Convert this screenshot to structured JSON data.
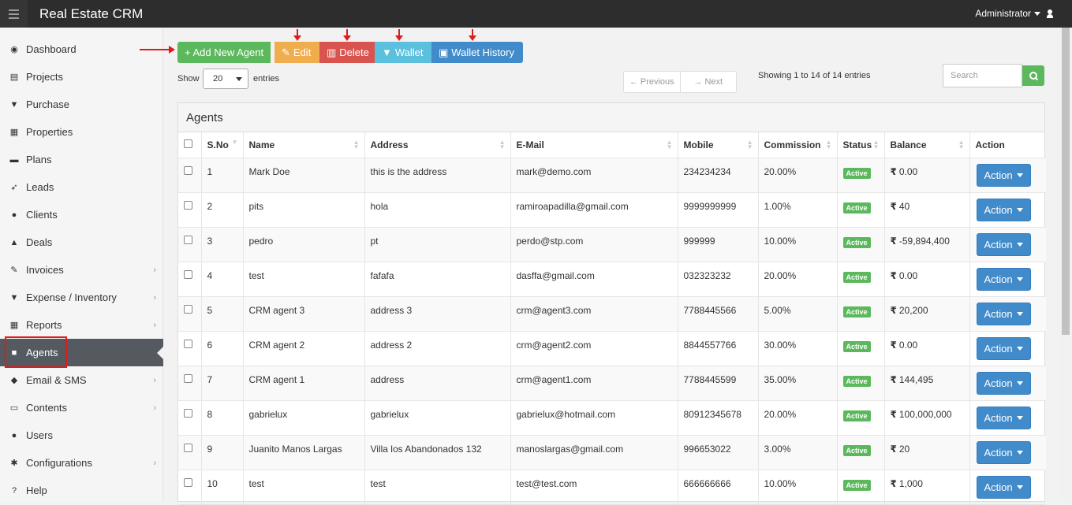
{
  "app": {
    "title": "Real Estate CRM",
    "user": "Administrator"
  },
  "colors": {
    "topbar": "#2d2d2d",
    "success": "#5cb85c",
    "warning": "#f0ad4e",
    "danger": "#d9534f",
    "info": "#5bc0de",
    "primary": "#428bca",
    "annotation": "#e01b1b"
  },
  "sidebar": {
    "items": [
      {
        "label": "Dashboard",
        "icon": "dashboard-icon",
        "glyph": "◉",
        "submenu": false
      },
      {
        "label": "Projects",
        "icon": "server-icon",
        "glyph": "▤",
        "submenu": false
      },
      {
        "label": "Purchase",
        "icon": "cart-icon",
        "glyph": "▼",
        "submenu": false
      },
      {
        "label": "Properties",
        "icon": "building-icon",
        "glyph": "▦",
        "submenu": false
      },
      {
        "label": "Plans",
        "icon": "briefcase-icon",
        "glyph": "▬",
        "submenu": false
      },
      {
        "label": "Leads",
        "icon": "rocket-icon",
        "glyph": "➶",
        "submenu": false
      },
      {
        "label": "Clients",
        "icon": "users-icon",
        "glyph": "●",
        "submenu": false
      },
      {
        "label": "Deals",
        "icon": "thumbs-up-icon",
        "glyph": "▲",
        "submenu": false
      },
      {
        "label": "Invoices",
        "icon": "pin-icon",
        "glyph": "✎",
        "submenu": true
      },
      {
        "label": "Expense / Inventory",
        "icon": "cart-icon",
        "glyph": "▼",
        "submenu": true
      },
      {
        "label": "Reports",
        "icon": "table-icon",
        "glyph": "▦",
        "submenu": true
      },
      {
        "label": "Agents",
        "icon": "agent-icon",
        "glyph": "■",
        "submenu": false,
        "active": true
      },
      {
        "label": "Email & SMS",
        "icon": "shield-icon",
        "glyph": "◆",
        "submenu": true
      },
      {
        "label": "Contents",
        "icon": "keyboard-icon",
        "glyph": "▭",
        "submenu": true
      },
      {
        "label": "Users",
        "icon": "user-icon",
        "glyph": "●",
        "submenu": false
      },
      {
        "label": "Configurations",
        "icon": "cogs-icon",
        "glyph": "✱",
        "submenu": true
      },
      {
        "label": "Help",
        "icon": "question-icon",
        "glyph": "?",
        "submenu": false
      }
    ]
  },
  "toolbar": {
    "add": "+ Add New Agent",
    "edit": "Edit",
    "delete": "Delete",
    "wallet": "Wallet",
    "wallet_history": "Wallet History"
  },
  "list": {
    "show_label": "Show",
    "entries_label": "entries",
    "page_size": "20",
    "previous": "← Previous",
    "next": "→ Next",
    "showing": "Showing 1 to 14 of 14 entries",
    "search_placeholder": "Search"
  },
  "panel": {
    "title": "Agents"
  },
  "table": {
    "headers": [
      "S.No",
      "Name",
      "Address",
      "E-Mail",
      "Mobile",
      "Commission",
      "Status",
      "Balance",
      "Action"
    ],
    "rows": [
      {
        "sno": "1",
        "name": "Mark Doe",
        "address": "this is the address",
        "email": "mark@demo.com",
        "mobile": "234234234",
        "commission": "20.00%",
        "status": "Active",
        "balance": "0.00",
        "action": "Action"
      },
      {
        "sno": "2",
        "name": "pits",
        "address": "hola",
        "email": "ramiroapadilla@gmail.com",
        "mobile": "9999999999",
        "commission": "1.00%",
        "status": "Active",
        "balance": "40",
        "action": "Action"
      },
      {
        "sno": "3",
        "name": "pedro",
        "address": "pt",
        "email": "perdo@stp.com",
        "mobile": "999999",
        "commission": "10.00%",
        "status": "Active",
        "balance": "-59,894,400",
        "action": "Action"
      },
      {
        "sno": "4",
        "name": "test",
        "address": "fafafa",
        "email": "dasffa@gmail.com",
        "mobile": "032323232",
        "commission": "20.00%",
        "status": "Active",
        "balance": "0.00",
        "action": "Action"
      },
      {
        "sno": "5",
        "name": "CRM agent 3",
        "address": "address 3",
        "email": "crm@agent3.com",
        "mobile": "7788445566",
        "commission": "5.00%",
        "status": "Active",
        "balance": "20,200",
        "action": "Action"
      },
      {
        "sno": "6",
        "name": "CRM agent 2",
        "address": "address 2",
        "email": "crm@agent2.com",
        "mobile": "8844557766",
        "commission": "30.00%",
        "status": "Active",
        "balance": "0.00",
        "action": "Action"
      },
      {
        "sno": "7",
        "name": "CRM agent 1",
        "address": "address",
        "email": "crm@agent1.com",
        "mobile": "7788445599",
        "commission": "35.00%",
        "status": "Active",
        "balance": "144,495",
        "action": "Action"
      },
      {
        "sno": "8",
        "name": "gabrielux",
        "address": "gabrielux",
        "email": "gabrielux@hotmail.com",
        "mobile": "80912345678",
        "commission": "20.00%",
        "status": "Active",
        "balance": "100,000,000",
        "action": "Action"
      },
      {
        "sno": "9",
        "name": "Juanito Manos Largas",
        "address": "Villa los Abandonados 132",
        "email": "manoslargas@gmail.com",
        "mobile": "996653022",
        "commission": "3.00%",
        "status": "Active",
        "balance": "20",
        "action": "Action"
      },
      {
        "sno": "10",
        "name": "test",
        "address": "test",
        "email": "test@test.com",
        "mobile": "666666666",
        "commission": "10.00%",
        "status": "Active",
        "balance": "1,000",
        "action": "Action"
      }
    ]
  },
  "currency_symbol": "₹"
}
